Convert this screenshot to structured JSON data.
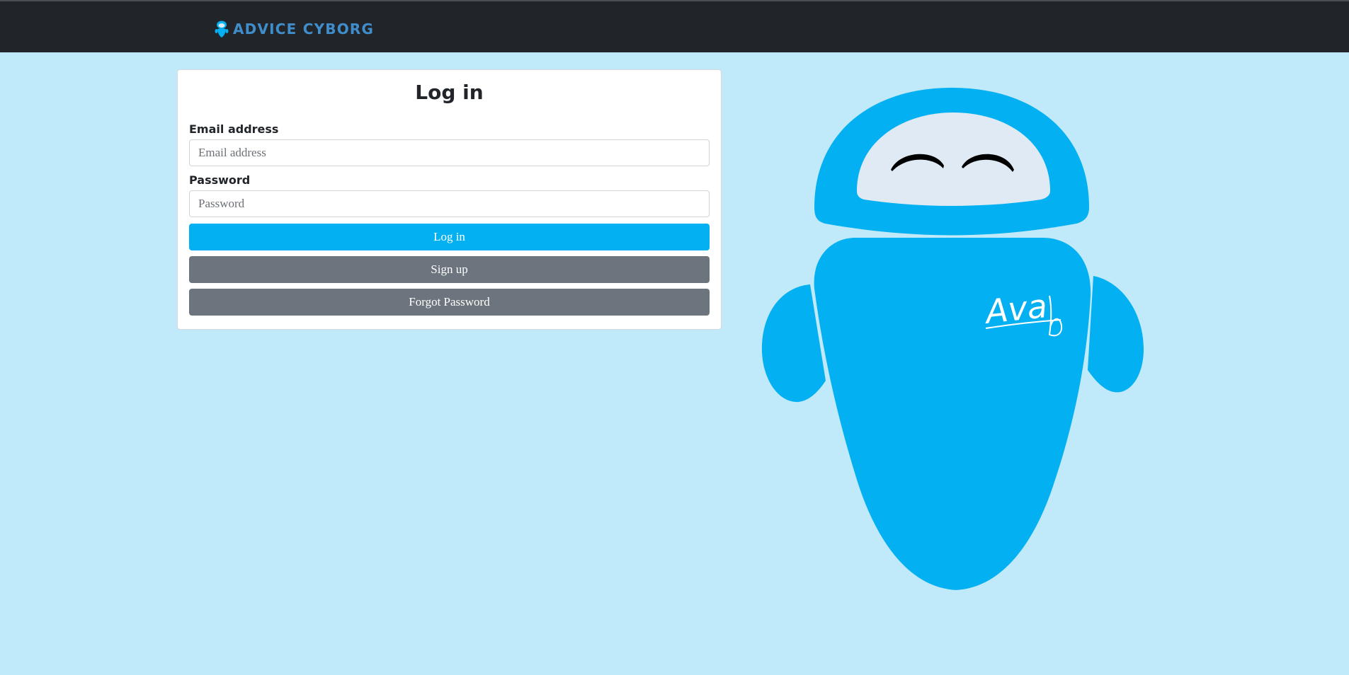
{
  "navbar": {
    "brand_label": "ADVICE CYBORG",
    "brand_icon": "robot-icon"
  },
  "login_form": {
    "title": "Log in",
    "email_label": "Email address",
    "email_placeholder": "Email address",
    "email_value": "",
    "password_label": "Password",
    "password_placeholder": "Password",
    "password_value": "",
    "login_button_label": "Log in",
    "signup_button_label": "Sign up",
    "forgot_password_button_label": "Forgot Password"
  },
  "mascot": {
    "name_label": "Ava"
  },
  "colors": {
    "background": "#c0e9f9",
    "navbar": "#212429",
    "brand_text": "#3f8ecb",
    "primary": "#03b0f1",
    "secondary": "#6c757d",
    "mascot_body": "#03b0f1",
    "mascot_face": "#dfeaf5"
  }
}
